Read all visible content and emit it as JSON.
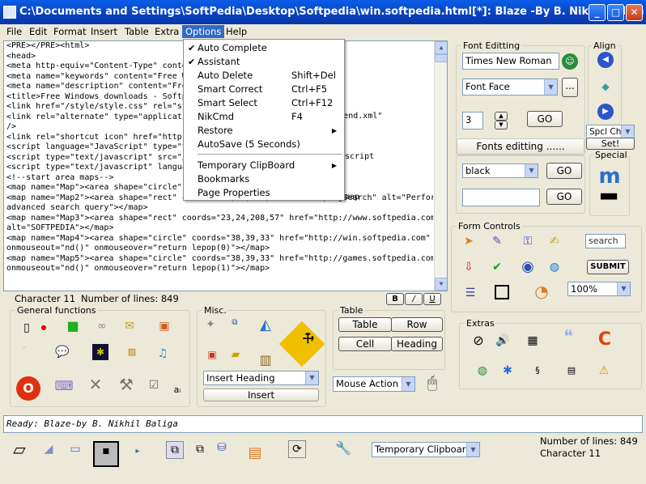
{
  "window": {
    "title": "C:\\Documents and Settings\\SoftPedia\\Desktop\\Softpedia\\win.softpedia.html[*]: Blaze -By B. Nikhil Baliga",
    "minimize": "_",
    "maximize": "□",
    "close": "✕"
  },
  "menu": [
    "File",
    "Edit",
    "Format",
    "Insert",
    "Table",
    "Extra",
    "Options",
    "Help"
  ],
  "options_menu": [
    {
      "label": "Auto Complete",
      "checked": "✔"
    },
    {
      "label": "Assistant",
      "checked": "✔"
    },
    {
      "label": "Auto Delete",
      "shortcut": "Shift+Del"
    },
    {
      "label": "Smart Correct",
      "shortcut": "Ctrl+F5"
    },
    {
      "label": "Smart Select",
      "shortcut": "Ctrl+F12"
    },
    {
      "label": "NikCmd",
      "shortcut": "F4"
    },
    {
      "label": "Restore",
      "arrow": "▶"
    },
    {
      "label": "AutoSave (5 Seconds)"
    },
    {
      "label": "Temporary ClipBoard",
      "arrow": "▶"
    },
    {
      "label": "Bookmarks"
    },
    {
      "label": "Page Properties"
    }
  ],
  "editor_lines": [
    "<PRE></PRE><html>",
    "<head>",
    "<meta http-equiv=\"Content-Type\" content=\"te",
    "<meta name=\"keywords\" content=\"Free Windo",
    "<meta name=\"description\" content=\"Free Win",
    "<title>Free Windows downloads - Softpedia</t",
    "<link href=\"/style/style.css\" rel=\"stylesheet\" ty",
    "<link rel=\"alternate\" type=\"application/rss+xml",
    "/>",
    "<link rel=\"shortcut icon\" href=\"http://www.so",
    "<script language=\"JavaScript\" type=\"text/java",
    "<script type=\"text/javascript\" src=\"/js/overlib_",
    "<script type=\"text/javascript\" language=\"Java",
    "<!--start area maps-->",
    "<map name=\"Map\"><area shape=\"circle\" coo",
    "<map name=\"Map2\"><area shape=\"rect\" coords=\"12,13,112,27\" href=\"/progSearch\" alt=\"Perform an",
    "advanced search query\"></map>",
    "<map name=\"Map3\"><area shape=\"rect\" coords=\"23,24,208,57\" href=\"http://www.softpedia.com/\"",
    "alt=\"SOFTPEDIA\"></map>",
    "<map name=\"Map4\"><area shape=\"circle\" coords=\"38,39,33\" href=\"http://win.softpedia.com\"",
    "onmouseout=\"nd()\" onmouseover=\"return lepop(0)\"></map>",
    "<map name=\"Map5\"><area shape=\"circle\" coords=\"38,39,33\" href=\"http://games.softpedia.com/\"",
    "onmouseout=\"nd()\" onmouseover=\"return lepop(1)\"></map>"
  ],
  "editor_partial": {
    "rss_tail": "href=\"/backend.xml\"",
    "overlib_tail": "script",
    "map_tail": "map"
  },
  "status": {
    "character": "Character 11",
    "lines": "Number of lines:  849",
    "bold": "B",
    "italic": "/",
    "underline": "U"
  },
  "font": {
    "group": "Font Editting",
    "font_name": "Times New Roman",
    "font_face": "Font Face",
    "more": "...",
    "size": "3",
    "go": "GO",
    "fonts_editing": "Fonts editting ......"
  },
  "color": {
    "value": "black",
    "go1": "GO",
    "go2": "GO"
  },
  "align": {
    "group": "Align",
    "spcl": "Spcl Ch",
    "set": "Set!"
  },
  "special": {
    "group": "Special"
  },
  "form_controls": {
    "group": "Form Controls",
    "search": "search",
    "submit": "SUBMIT",
    "zoom": "100%"
  },
  "extras": {
    "group": "Extras"
  },
  "general": {
    "group": "General functions"
  },
  "misc": {
    "group": "Misc.",
    "insert_heading": "Insert Heading",
    "insert": "Insert"
  },
  "table": {
    "group": "Table",
    "table": "Table",
    "row": "Row",
    "cell": "Cell",
    "heading": "Heading",
    "mouse_action": "Mouse Action"
  },
  "statusbar": {
    "ready": "Ready: Blaze-by B. Nikhil Baliga"
  },
  "bottom": {
    "clipboard": "Temporary Clipboard",
    "lines": "Number of lines:  849",
    "character": "Character 11"
  }
}
